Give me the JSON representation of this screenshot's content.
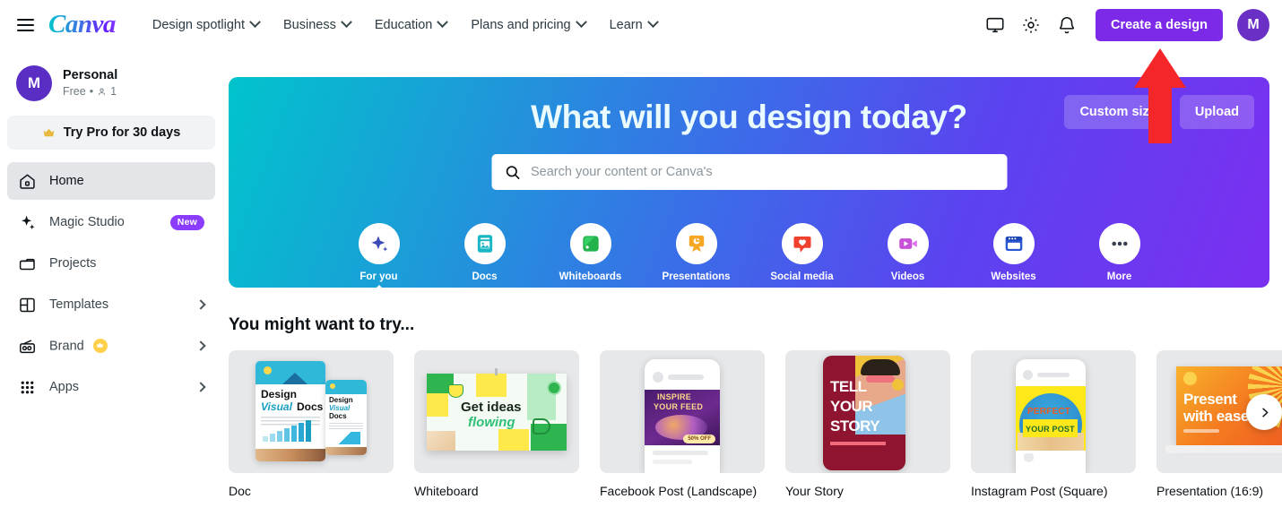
{
  "header": {
    "menu_icon": "hamburger-icon",
    "brand": "Canva",
    "nav": [
      {
        "label": "Design spotlight",
        "has_chevron": true
      },
      {
        "label": "Business",
        "has_chevron": true
      },
      {
        "label": "Education",
        "has_chevron": true
      },
      {
        "label": "Plans and pricing",
        "has_chevron": true
      },
      {
        "label": "Learn",
        "has_chevron": true
      }
    ],
    "icons": [
      "monitor-icon",
      "gear-icon",
      "bell-icon"
    ],
    "cta_label": "Create a design",
    "avatar_initial": "M"
  },
  "sidebar": {
    "account": {
      "initial": "M",
      "name": "Personal",
      "plan": "Free",
      "separator": "•",
      "members": "1"
    },
    "try_pro_label": "Try Pro for 30 days",
    "items": [
      {
        "label": "Home",
        "icon": "home-icon",
        "active": true,
        "chevron": false,
        "badge": ""
      },
      {
        "label": "Magic Studio",
        "icon": "sparkle-icon",
        "active": false,
        "chevron": false,
        "badge": "New"
      },
      {
        "label": "Projects",
        "icon": "folder-icon",
        "active": false,
        "chevron": false,
        "badge": ""
      },
      {
        "label": "Templates",
        "icon": "templates-icon",
        "active": false,
        "chevron": true,
        "badge": ""
      },
      {
        "label": "Brand",
        "icon": "brand-icon",
        "active": false,
        "chevron": true,
        "badge": "",
        "crown": true
      },
      {
        "label": "Apps",
        "icon": "apps-grid-icon",
        "active": false,
        "chevron": true,
        "badge": ""
      }
    ]
  },
  "hero": {
    "title": "What will you design today?",
    "custom_size_label": "Custom size",
    "upload_label": "Upload",
    "search_placeholder": "Search your content or Canva's",
    "search_value": "",
    "gradient_start": "#00c4cc",
    "gradient_end": "#7b2ff0",
    "categories": [
      {
        "label": "For you",
        "icon": "sparkle-icon",
        "active": true
      },
      {
        "label": "Docs",
        "icon": "doc-icon",
        "active": false
      },
      {
        "label": "Whiteboards",
        "icon": "whiteboard-icon",
        "active": false
      },
      {
        "label": "Presentations",
        "icon": "presentation-icon",
        "active": false
      },
      {
        "label": "Social media",
        "icon": "heart-bubble-icon",
        "active": false
      },
      {
        "label": "Videos",
        "icon": "video-camera-icon",
        "active": false
      },
      {
        "label": "Websites",
        "icon": "browser-window-icon",
        "active": false
      },
      {
        "label": "More",
        "icon": "more-dots-icon",
        "active": false
      }
    ]
  },
  "annotation": {
    "shape": "up-arrow",
    "color": "#f5262a"
  },
  "suggestions": {
    "title": "You might want to try...",
    "next_icon": "chevron-right-icon",
    "cards": [
      {
        "label": "Doc",
        "thumb_text_1": "Design",
        "thumb_text_2": "Visual",
        "thumb_text_3": "Docs"
      },
      {
        "label": "Whiteboard",
        "thumb_text_1": "Get ideas",
        "thumb_text_2": "flowing"
      },
      {
        "label": "Facebook Post (Landscape)",
        "thumb_text_1": "INSPIRE",
        "thumb_text_2": "YOUR FEED",
        "thumb_text_3": "50% OFF"
      },
      {
        "label": "Your Story",
        "thumb_text_1": "TELL",
        "thumb_text_2": "YOUR",
        "thumb_text_3": "STORY"
      },
      {
        "label": "Instagram Post (Square)",
        "thumb_text_1": "PERFECT",
        "thumb_text_2": "YOUR POST"
      },
      {
        "label": "Presentation (16:9)",
        "thumb_text_1": "Present",
        "thumb_text_2": "with ease"
      }
    ]
  }
}
